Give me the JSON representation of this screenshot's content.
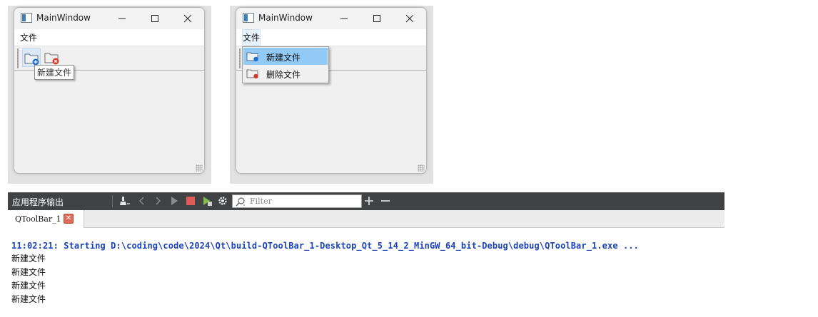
{
  "window_left": {
    "title": "MainWindow",
    "menu": "文件",
    "tooltip": "新建文件",
    "toolbar_icons": [
      "new-file-icon",
      "delete-file-icon"
    ]
  },
  "window_right": {
    "title": "MainWindow",
    "menu": "文件",
    "dropdown": [
      {
        "label": "新建文件",
        "icon": "new-file-icon",
        "selected": true
      },
      {
        "label": "删除文件",
        "icon": "delete-file-icon",
        "selected": false
      }
    ]
  },
  "output_pane": {
    "title": "应用程序输出",
    "filter_placeholder": "Filter",
    "tab_label": "QToolBar_1",
    "start_line": "11:02:21: Starting D:\\coding\\code\\2024\\Qt\\build-QToolBar_1-Desktop_Qt_5_14_2_MinGW_64_bit-Debug\\debug\\QToolBar_1.exe ...",
    "lines": [
      "新建文件",
      "新建文件",
      "新建文件",
      "新建文件"
    ]
  },
  "colors": {
    "selection": "#91c9f7",
    "output_bar": "#404244",
    "start_text": "#1a43b8",
    "stop_button": "#e05a5a"
  }
}
